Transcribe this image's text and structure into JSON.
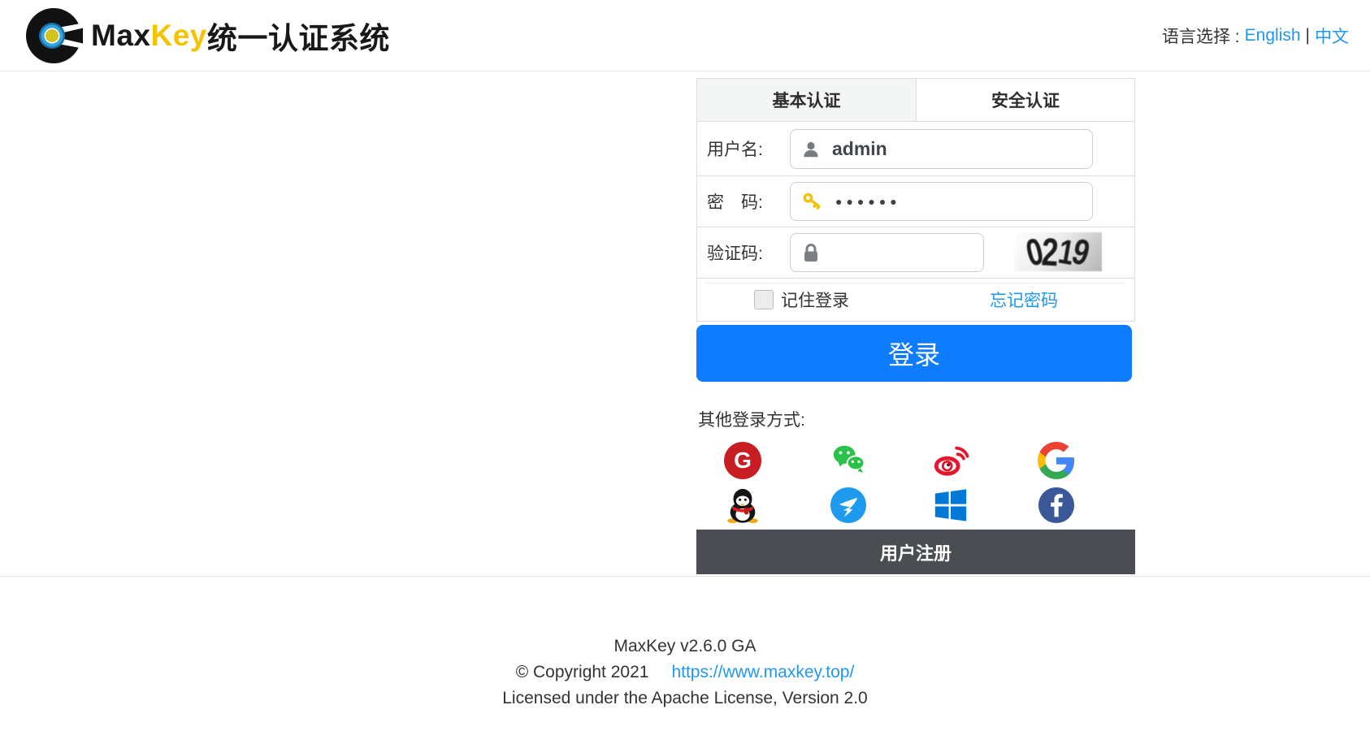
{
  "header": {
    "brand_part1": "Max",
    "brand_part2": "Key",
    "brand_part3": "统一认证系统",
    "language_label": "语言选择 :",
    "language_english": "English",
    "language_divider": "|",
    "language_chinese": "中文"
  },
  "login": {
    "tab_basic": "基本认证",
    "tab_secure": "安全认证",
    "username_label": "用户名:",
    "username_value": "admin",
    "password_label": "密　码:",
    "password_dots": "●●●●●●",
    "captcha_label": "验证码:",
    "captcha_digit1": "0",
    "captcha_digit2": "2",
    "captcha_digit3": "1",
    "captcha_digit4": "9",
    "remember_label": "记住登录",
    "forgot_password": "忘记密码",
    "login_button": "登录",
    "other_methods_label": "其他登录方式:",
    "register_label": "用户注册",
    "gitee_letter": "G",
    "providers_row1": [
      "gitee",
      "wechat",
      "weibo",
      "google"
    ],
    "providers_row2": [
      "qq",
      "dingtalk",
      "windows",
      "facebook"
    ]
  },
  "footer": {
    "version": "MaxKey  v2.6.0 GA",
    "copyright": "© Copyright 2021",
    "link": "https://www.maxkey.top/",
    "license": "Licensed under the Apache License, Version 2.0"
  },
  "colors": {
    "accent_blue": "#0d7cff",
    "link_blue": "#2196f3",
    "brand_gold": "#f5c400",
    "register_bar": "#4a4d52",
    "gitee_red": "#c71d23",
    "wechat_green": "#2bc24a",
    "weibo_red": "#e6162d",
    "qq_black": "#141414",
    "dingtalk_blue": "#1e9bef",
    "windows_blue": "#0078d7",
    "facebook_navy": "#3a5898"
  }
}
